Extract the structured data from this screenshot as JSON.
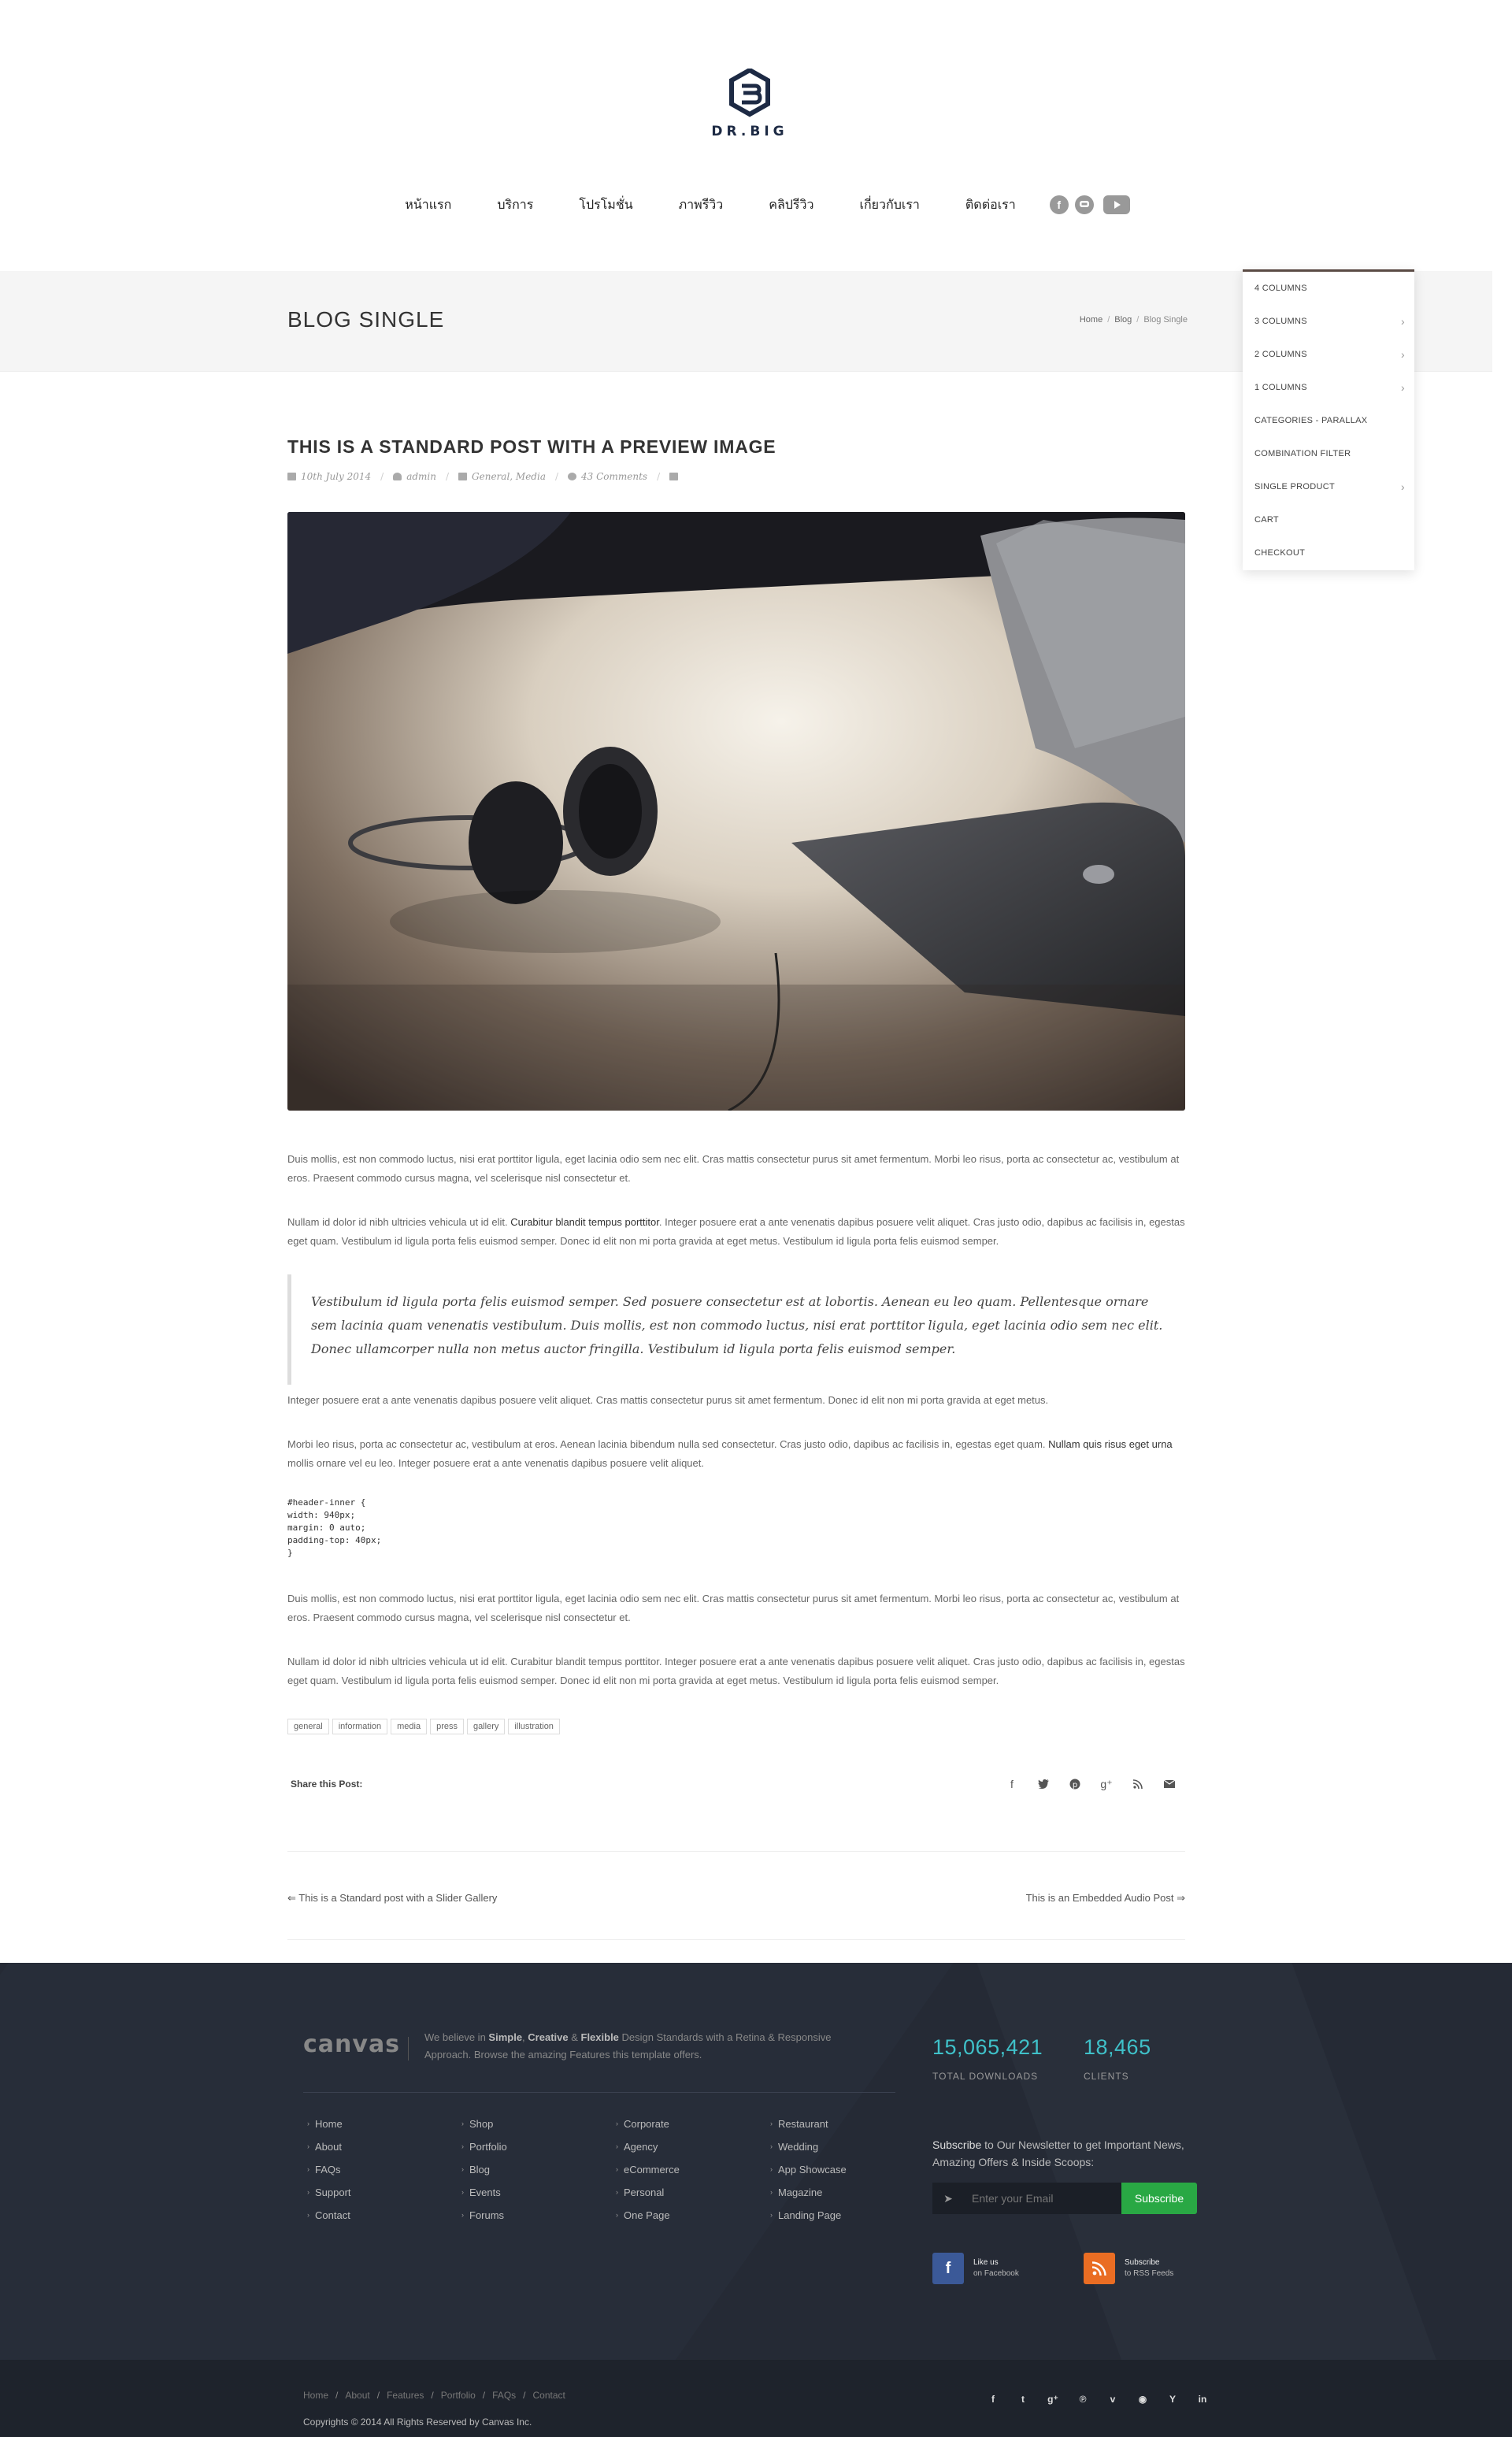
{
  "brand": {
    "name": "DR.BIG"
  },
  "nav": {
    "items": [
      "หน้าแรก",
      "บริการ",
      "โปรโมชั่น",
      "ภาพรีวิว",
      "คลิปรีวิว",
      "เกี่ยวกับเรา",
      "ติดต่อเรา"
    ],
    "socials": [
      "facebook-icon",
      "line-icon",
      "youtube-icon"
    ]
  },
  "page_title": {
    "title": "Blog Single",
    "breadcrumb": [
      "Home",
      "Blog",
      "Blog Single"
    ]
  },
  "dropdown": {
    "items": [
      {
        "label": "4 COLUMNS",
        "submenu": false
      },
      {
        "label": "3 COLUMNS",
        "submenu": true
      },
      {
        "label": "2 COLUMNS",
        "submenu": true
      },
      {
        "label": "1 COLUMNS",
        "submenu": true
      },
      {
        "label": "CATEGORIES - PARALLAX",
        "submenu": false
      },
      {
        "label": "COMBINATION FILTER",
        "submenu": false
      },
      {
        "label": "SINGLE PRODUCT",
        "submenu": true
      },
      {
        "label": "CART",
        "submenu": false
      },
      {
        "label": "CHECKOUT",
        "submenu": false
      }
    ]
  },
  "post": {
    "title": "This is a Standard post with a Preview Image",
    "meta": {
      "date": "10th July 2014",
      "author": "admin",
      "categories": "General, Media",
      "comments": "43 Comments"
    },
    "p1": "Duis mollis, est non commodo luctus, nisi erat porttitor ligula, eget lacinia odio sem nec elit. Cras mattis consectetur purus sit amet fermentum. Morbi leo risus, porta ac consectetur ac, vestibulum at eros. Praesent commodo cursus magna, vel scelerisque nisl consectetur et.",
    "p2_a": "Nullam id dolor id nibh ultricies vehicula ut id elit. ",
    "p2_link": "Curabitur blandit tempus porttitor",
    "p2_b": ". Integer posuere erat a ante venenatis dapibus posuere velit aliquet. Cras justo odio, dapibus ac facilisis in, egestas eget quam. Vestibulum id ligula porta felis euismod semper. Donec id elit non mi porta gravida at eget metus. Vestibulum id ligula porta felis euismod semper.",
    "quote": "Vestibulum id ligula porta felis euismod semper. Sed posuere consectetur est at lobortis. Aenean eu leo quam. Pellentesque ornare sem lacinia quam venenatis vestibulum. Duis mollis, est non commodo luctus, nisi erat porttitor ligula, eget lacinia odio sem nec elit. Donec ullamcorper nulla non metus auctor fringilla. Vestibulum id ligula porta felis euismod semper.",
    "p3": "Integer posuere erat a ante venenatis dapibus posuere velit aliquet. Cras mattis consectetur purus sit amet fermentum. Donec id elit non mi porta gravida at eget metus.",
    "p4_a": "Morbi leo risus, porta ac consectetur ac, vestibulum at eros. Aenean lacinia bibendum nulla sed consectetur. Cras justo odio, dapibus ac facilisis in, egestas eget quam. ",
    "p4_link": "Nullam quis risus eget urna",
    "p4_b": " mollis ornare vel eu leo. Integer posuere erat a ante venenatis dapibus posuere velit aliquet.",
    "code": "#header-inner {\nwidth: 940px;\nmargin: 0 auto;\npadding-top: 40px;\n}",
    "p5": "Duis mollis, est non commodo luctus, nisi erat porttitor ligula, eget lacinia odio sem nec elit. Cras mattis consectetur purus sit amet fermentum. Morbi leo risus, porta ac consectetur ac, vestibulum at eros. Praesent commodo cursus magna, vel scelerisque nisl consectetur et.",
    "p6": "Nullam id dolor id nibh ultricies vehicula ut id elit. Curabitur blandit tempus porttitor. Integer posuere erat a ante venenatis dapibus posuere velit aliquet. Cras justo odio, dapibus ac facilisis in, egestas eget quam. Vestibulum id ligula porta felis euismod semper. Donec id elit non mi porta gravida at eget metus. Vestibulum id ligula porta felis euismod semper.",
    "tags": [
      "general",
      "information",
      "media",
      "press",
      "gallery",
      "illustration"
    ],
    "share_label": "Share this Post:",
    "share_icons": [
      "facebook-icon",
      "twitter-icon",
      "pinterest-icon",
      "google-plus-icon",
      "rss-icon",
      "email-icon"
    ],
    "prev": "⇐ This is a Standard post with a Slider Gallery",
    "next": "This is an Embedded Audio Post ⇒"
  },
  "footer": {
    "logo": "canvas",
    "about_pre": "We believe in ",
    "about_b1": "Simple",
    "about_sep1": ", ",
    "about_b2": "Creative",
    "about_sep2": " & ",
    "about_b3": "Flexible",
    "about_post": " Design Standards with a Retina & Responsive Approach. Browse the amazing Features this template offers.",
    "links": [
      [
        "Home",
        "About",
        "FAQs",
        "Support",
        "Contact"
      ],
      [
        "Shop",
        "Portfolio",
        "Blog",
        "Events",
        "Forums"
      ],
      [
        "Corporate",
        "Agency",
        "eCommerce",
        "Personal",
        "One Page"
      ],
      [
        "Restaurant",
        "Wedding",
        "App Showcase",
        "Magazine",
        "Landing Page"
      ]
    ],
    "stats": [
      {
        "value": "15,065,421",
        "label": "Total Downloads"
      },
      {
        "value": "18,465",
        "label": "Clients"
      }
    ],
    "newsletter_b": "Subscribe",
    "newsletter_text": " to Our Newsletter to get Important News, Amazing Offers & Inside Scoops:",
    "email_placeholder": "Enter your Email",
    "subscribe_btn": "Subscribe",
    "fb_line1": "Like us",
    "fb_line2": "on Facebook",
    "rss_line1": "Subscribe",
    "rss_line2": "to RSS Feeds",
    "copy_links": [
      "Home",
      "About",
      "Features",
      "Portfolio",
      "FAQs",
      "Contact"
    ],
    "copyright": "Copyrights © 2014 All Rights Reserved by Canvas Inc.",
    "social_icons": [
      "facebook-icon",
      "twitter-icon",
      "google-plus-icon",
      "pinterest-icon",
      "vimeo-icon",
      "github-icon",
      "yahoo-icon",
      "linkedin-icon"
    ]
  },
  "colors": {
    "accent": "#3fc1c9",
    "subscribe": "#29a844",
    "footer_bg": "#252a35",
    "facebook": "#3b5998",
    "rss": "#ea6d23"
  }
}
